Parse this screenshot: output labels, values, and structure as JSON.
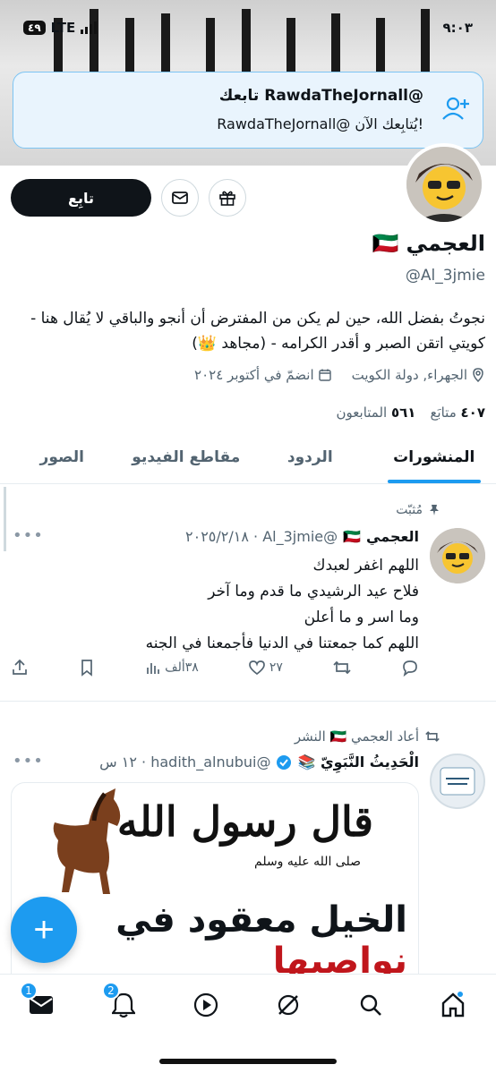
{
  "status_bar": {
    "time": "٩:٠٣",
    "network": "LTE",
    "battery": "٤٩"
  },
  "toast": {
    "title": "@RawdaTheJornall تابعك",
    "subtitle": "!يُتابِعك الآن @RawdaTheJornall",
    "icon": "person-add-icon"
  },
  "profile": {
    "follow_label": "تابِع",
    "name": "العجمي",
    "flag": "🇰🇼",
    "handle": "@Al_3jmie",
    "bio": "نجوتُ بفضل الله، حين لم يكن من المفترض أن أنجو والباقي لا يُقال هنا - كويتي اتقن الصبر و أقدر الكرامه - (مجاهد 👑)",
    "location": "الجهراء, دولة الكويت",
    "joined": "انضمّ في أكتوبر ٢٠٢٤",
    "following_count": "٤٠٧",
    "following_label": "متابَع",
    "followers_count": "٥٦١",
    "followers_label": "المتابعون"
  },
  "tabs": [
    {
      "label": "المنشورات",
      "active": true
    },
    {
      "label": "الردود",
      "active": false
    },
    {
      "label": "مقاطع الفيديو",
      "active": false
    },
    {
      "label": "الصور",
      "active": false
    }
  ],
  "pinned_post": {
    "pinned_label": "مُثبّت",
    "author": "العجمي",
    "flag": "🇰🇼",
    "handle_date": "@Al_3jmie · ٢٠٢٥/٢/١٨",
    "lines": [
      "اللهم اغفر لعبدك",
      "فلاح عيد الرشيدي ما قدم وما آخر",
      "وما اسر و ما أعلن",
      "اللهم كما جمعتنا في الدنيا فأجمعنا في الجنه"
    ],
    "views": "٣٨ألف",
    "likes": "٢٧"
  },
  "repost": {
    "repost_label": "أعاد العجمي 🇰🇼 النشر",
    "author": "الْحَدِيثُ النَّبَوِيّ 📚",
    "handle_time": "@hadith_alnubui · ١٢ س",
    "media_title": "قال رسول الله",
    "media_subtitle": "صلى الله عليه وسلم",
    "media_line_black": "الخيل معقود في ",
    "media_line_red": "نواصيها"
  },
  "fab_label": "+",
  "nav": {
    "messages_badge": "1",
    "notifications_badge": "2"
  },
  "colors": {
    "accent": "#1d9bf0",
    "text": "#0f1419",
    "muted": "#536471",
    "toast_bg": "#e9f4fd"
  }
}
